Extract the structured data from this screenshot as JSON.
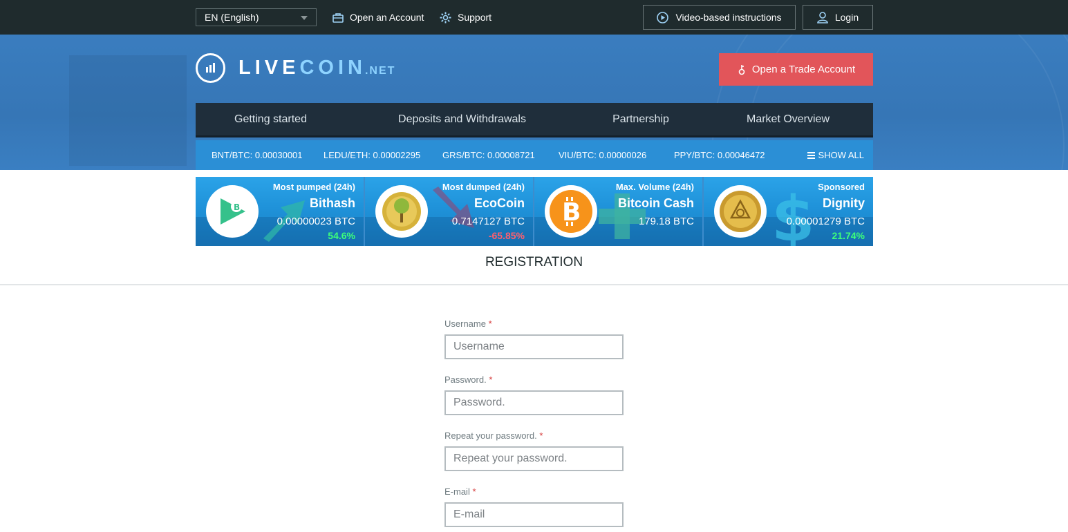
{
  "topbar": {
    "language": "EN (English)",
    "open_account": "Open an Account",
    "support": "Support",
    "video_instructions": "Video-based instructions",
    "login": "Login"
  },
  "header": {
    "logo_live": "LIVE",
    "logo_coin": "COIN",
    "logo_net": ".NET",
    "trade_button": "Open a Trade Account"
  },
  "nav": {
    "items": [
      {
        "label": "Getting started"
      },
      {
        "label": "Deposits and Withdrawals"
      },
      {
        "label": "Partnership"
      },
      {
        "label": "Market Overview"
      }
    ]
  },
  "ticker": {
    "items": [
      {
        "label": "BNT/BTC: 0.00030001"
      },
      {
        "label": "LEDU/ETH: 0.00002295"
      },
      {
        "label": "GRS/BTC: 0.00008721"
      },
      {
        "label": "VIU/BTC: 0.00000026"
      },
      {
        "label": "PPY/BTC: 0.00046472"
      }
    ],
    "show_all": "SHOW ALL"
  },
  "cards": [
    {
      "label": "Most pumped (24h)",
      "name": "Bithash",
      "price": "0.00000023 BTC",
      "change": "54.6%",
      "change_color": "#3dff7a",
      "icon": "bithash-icon"
    },
    {
      "label": "Most dumped (24h)",
      "name": "EcoCoin",
      "price": "0.7147127 BTC",
      "change": "-65.85%",
      "change_color": "#ff5f6e",
      "icon": "ecocoin-icon"
    },
    {
      "label": "Max. Volume (24h)",
      "name": "Bitcoin Cash",
      "price": "179.18 BTC",
      "change": "",
      "change_color": "#ffffff",
      "icon": "bitcoin-cash-icon"
    },
    {
      "label": "Sponsored",
      "name": "Dignity",
      "price": "0.00001279 BTC",
      "change": "21.74%",
      "change_color": "#3dff7a",
      "icon": "dignity-icon"
    }
  ],
  "registration": {
    "title": "REGISTRATION",
    "fields": [
      {
        "label": "Username",
        "placeholder": "Username"
      },
      {
        "label": "Password.",
        "placeholder": "Password."
      },
      {
        "label": "Repeat your password.",
        "placeholder": "Repeat your password."
      },
      {
        "label": "E-mail",
        "placeholder": "E-mail"
      }
    ],
    "required_mark": "*"
  },
  "colors": {
    "topbar_bg": "#1f2b2d",
    "hero_bg": "#3676b6",
    "trade_button": "#e2555a",
    "nav_bg": "#1f2e3b",
    "ticker_bg": "#2b8fd6",
    "positive": "#3dff7a",
    "negative": "#ff5f6e"
  }
}
